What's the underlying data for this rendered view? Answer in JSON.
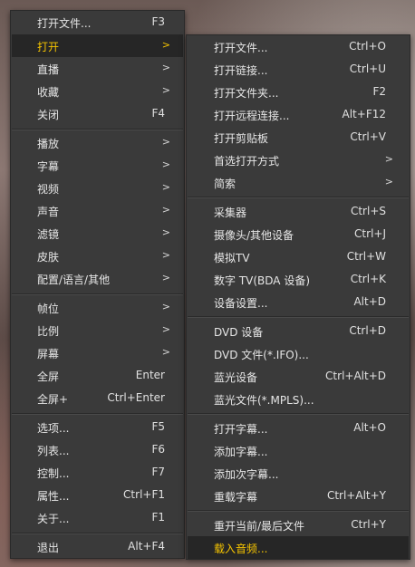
{
  "main_menu": {
    "open_file": {
      "label": "打开文件...",
      "shortcut": "F3"
    },
    "open": {
      "label": "打开",
      "arrow": ">"
    },
    "playback": {
      "label": "直播",
      "arrow": ">"
    },
    "favorites": {
      "label": "收藏",
      "arrow": ">"
    },
    "close": {
      "label": "关闭",
      "shortcut": "F4"
    },
    "play": {
      "label": "播放",
      "arrow": ">"
    },
    "subtitles": {
      "label": "字幕",
      "arrow": ">"
    },
    "video": {
      "label": "视频",
      "arrow": ">"
    },
    "audio": {
      "label": "声音",
      "arrow": ">"
    },
    "filters": {
      "label": "滤镜",
      "arrow": ">"
    },
    "skins": {
      "label": "皮肤",
      "arrow": ">"
    },
    "config": {
      "label": "配置/语言/其他",
      "arrow": ">"
    },
    "frame": {
      "label": "帧位",
      "arrow": ">"
    },
    "ratio": {
      "label": "比例",
      "arrow": ">"
    },
    "screen": {
      "label": "屏幕",
      "arrow": ">"
    },
    "fullscreen": {
      "label": "全屏",
      "shortcut": "Enter"
    },
    "fullscreen_plus": {
      "label": "全屏+",
      "shortcut": "Ctrl+Enter"
    },
    "options": {
      "label": "选项...",
      "shortcut": "F5"
    },
    "playlist": {
      "label": "列表...",
      "shortcut": "F6"
    },
    "control": {
      "label": "控制...",
      "shortcut": "F7"
    },
    "properties": {
      "label": "属性...",
      "shortcut": "Ctrl+F1"
    },
    "about": {
      "label": "关于...",
      "shortcut": "F1"
    },
    "exit": {
      "label": "退出",
      "shortcut": "Alt+F4"
    }
  },
  "open_submenu": {
    "open_file": {
      "label": "打开文件...",
      "shortcut": "Ctrl+O"
    },
    "open_link": {
      "label": "打开链接...",
      "shortcut": "Ctrl+U"
    },
    "open_folder": {
      "label": "打开文件夹...",
      "shortcut": "F2"
    },
    "open_remote": {
      "label": "打开远程连接...",
      "shortcut": "Alt+F12"
    },
    "open_clipboard": {
      "label": "打开剪贴板",
      "shortcut": "Ctrl+V"
    },
    "preferred_open": {
      "label": "首选打开方式",
      "arrow": ">"
    },
    "simple": {
      "label": "简索",
      "arrow": ">"
    },
    "capture": {
      "label": "采集器",
      "shortcut": "Ctrl+S"
    },
    "camera": {
      "label": "摄像头/其他设备",
      "shortcut": "Ctrl+J"
    },
    "analog_tv": {
      "label": "模拟TV",
      "shortcut": "Ctrl+W"
    },
    "digital_tv": {
      "label": "数字 TV(BDA 设备)",
      "shortcut": "Ctrl+K"
    },
    "device_settings": {
      "label": "设备设置...",
      "shortcut": "Alt+D"
    },
    "dvd_device": {
      "label": "DVD 设备",
      "shortcut": "Ctrl+D"
    },
    "dvd_file": {
      "label": "DVD 文件(*.IFO)..."
    },
    "bluray_device": {
      "label": "蓝光设备",
      "shortcut": "Ctrl+Alt+D"
    },
    "bluray_file": {
      "label": "蓝光文件(*.MPLS)..."
    },
    "open_subtitle": {
      "label": "打开字幕...",
      "shortcut": "Alt+O"
    },
    "add_subtitle": {
      "label": "添加字幕..."
    },
    "add_secondary_subtitle": {
      "label": "添加次字幕..."
    },
    "reload_subtitle": {
      "label": "重载字幕",
      "shortcut": "Ctrl+Alt+Y"
    },
    "reopen_last": {
      "label": "重开当前/最后文件",
      "shortcut": "Ctrl+Y"
    },
    "load_audio": {
      "label": "载入音频..."
    }
  },
  "colors": {
    "menu_bg": "#3a3a3a",
    "highlight_bg": "#262626",
    "highlight_text": "#f5c400",
    "text": "#e6e6e6"
  }
}
